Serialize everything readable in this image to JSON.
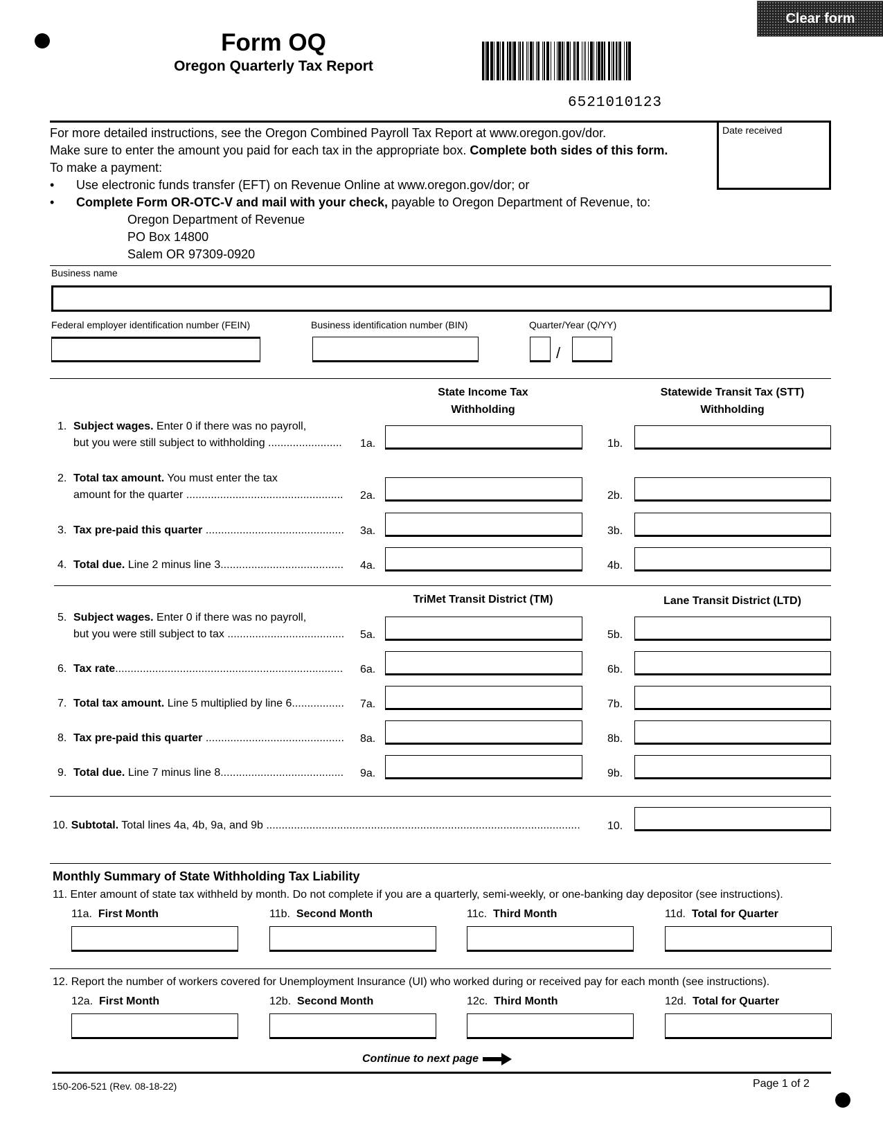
{
  "header": {
    "title": "Form OQ",
    "subtitle": "Oregon Quarterly Tax Report",
    "clear_button": "Clear form",
    "barcode_number": "6521010123",
    "date_received_label": "Date received"
  },
  "instructions": {
    "line1": "For more detailed instructions, see the Oregon Combined Payroll Tax Report at www.oregon.gov/dor.",
    "line2_normal": "Make sure to enter the amount you paid for each tax in the appropriate box. ",
    "line2_bold": "Complete both sides of this form.",
    "line3": "To make a payment:",
    "bullet1": "Use electronic funds transfer (EFT) on Revenue Online at www.oregon.gov/dor; or",
    "bullet2_bold": "Complete Form OR-OTC-V and mail with your check,",
    "bullet2_normal": " payable to Oregon Department of Revenue, to:",
    "address": [
      "Oregon Department of Revenue",
      "PO Box 14800",
      "Salem OR 97309-0920"
    ],
    "bullet_glyph": "•"
  },
  "identity": {
    "business_name_label": "Business name",
    "business_name_value": "",
    "fein_label": "Federal employer identification number (FEIN)",
    "fein_value": "",
    "bin_label": "Business identification number (BIN)",
    "bin_value": "",
    "quarter_year_label": "Quarter/Year (Q/YY)",
    "quarter_value": "",
    "year_value": "",
    "separator": "/"
  },
  "section1": {
    "col_a": [
      "State Income Tax",
      "Withholding"
    ],
    "col_b": [
      "Statewide Transit Tax (STT)",
      "Withholding"
    ],
    "lines": [
      {
        "num": "1.",
        "bold": "Subject wages.",
        "text": " Enter 0 if there was no payroll,",
        "text2": "but you were still subject to withholding ........................",
        "a": "1a.",
        "b": "1b."
      },
      {
        "num": "2.",
        "bold": "Total tax amount.",
        "text": " You must enter the tax",
        "text2": "amount for the quarter ...................................................",
        "a": "2a.",
        "b": "2b."
      },
      {
        "num": "3.",
        "bold": "Tax pre-paid this quarter",
        "text": " .............................................",
        "text2": "",
        "a": "3a.",
        "b": "3b."
      },
      {
        "num": "4.",
        "bold": "Total due.",
        "text": " Line 2 minus line 3........................................",
        "text2": "",
        "a": "4a.",
        "b": "4b."
      }
    ]
  },
  "section2": {
    "col_a": "TriMet Transit District (TM)",
    "col_b": "Lane Transit District (LTD)",
    "lines": [
      {
        "num": "5.",
        "bold": "Subject wages.",
        "text": " Enter 0 if there was no payroll,",
        "text2": "but you were still subject to tax ......................................",
        "a": "5a.",
        "b": "5b."
      },
      {
        "num": "6.",
        "bold": "Tax rate",
        "text": "..........................................................................",
        "text2": "",
        "a": "6a.",
        "b": "6b."
      },
      {
        "num": "7.",
        "bold": "Total tax amount.",
        "text": " Line 5 multiplied by line 6.................",
        "text2": "",
        "a": "7a.",
        "b": "7b."
      },
      {
        "num": "8.",
        "bold": "Tax pre-paid this quarter",
        "text": " .............................................",
        "text2": "",
        "a": "8a.",
        "b": "8b."
      },
      {
        "num": "9.",
        "bold": "Total due.",
        "text": " Line 7 minus line 8........................................",
        "text2": "",
        "a": "9a.",
        "b": "9b."
      }
    ]
  },
  "subtotal": {
    "num": "10.",
    "bold": "Subtotal.",
    "text": " Total lines 4a, 4b, 9a, and 9b ......................................................................................................",
    "id": "10."
  },
  "monthly": {
    "title": "Monthly Summary of State Withholding Tax Liability",
    "line11": "11. Enter amount of state tax withheld by month. Do not complete if you are a quarterly, semi-weekly, or one-banking day depositor (see instructions).",
    "items11": [
      {
        "id": "11a.",
        "label": "First Month"
      },
      {
        "id": "11b.",
        "label": "Second Month"
      },
      {
        "id": "11c.",
        "label": "Third Month"
      },
      {
        "id": "11d.",
        "label": "Total for Quarter"
      }
    ],
    "line12": "12. Report the number of workers covered for Unemployment Insurance (UI) who worked during or received pay for each month (see instructions).",
    "items12": [
      {
        "id": "12a.",
        "label": "First Month"
      },
      {
        "id": "12b.",
        "label": "Second Month"
      },
      {
        "id": "12c.",
        "label": "Third Month"
      },
      {
        "id": "12d.",
        "label": "Total for Quarter"
      }
    ]
  },
  "footer": {
    "continue": "Continue to next page",
    "form_number": "150-206-521 (Rev. 08-18-22)",
    "page": "Page 1 of 2"
  }
}
